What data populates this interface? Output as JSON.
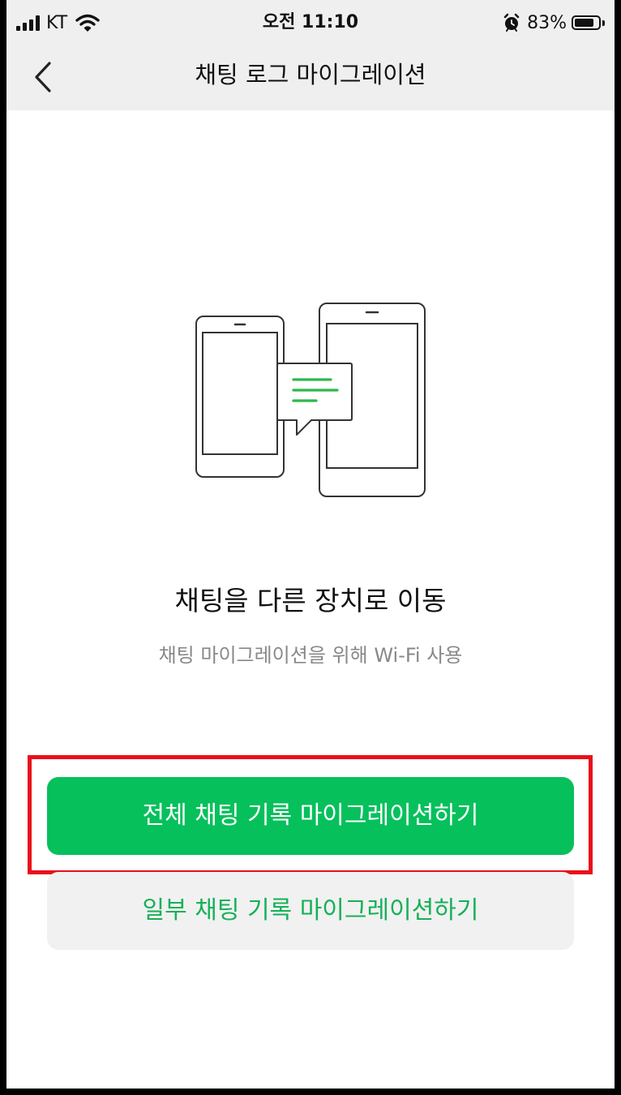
{
  "status_bar": {
    "carrier": "KT",
    "time": "오전 11:10",
    "battery_percent": "83%",
    "battery_level": 0.83,
    "icons": [
      "signal-icon",
      "wifi-icon",
      "alarm-icon",
      "battery-icon"
    ]
  },
  "nav": {
    "title": "채팅 로그 마이그레이션",
    "back_icon": "chevron-left-icon"
  },
  "illustration": {
    "icon": "phones-migration-icon",
    "accent_color": "#2db84a"
  },
  "content": {
    "title": "채팅을 다른 장치로 이동",
    "subtitle": "채팅 마이그레이션을 위해 Wi-Fi 사용"
  },
  "buttons": {
    "migrate_all": "전체 채팅 기록 마이그레이션하기",
    "migrate_partial": "일부 채팅 기록 마이그레이션하기"
  },
  "colors": {
    "primary_green": "#06c05c",
    "secondary_text_green": "#15b158",
    "highlight_red": "#e8101b",
    "header_bg": "#efefef"
  }
}
